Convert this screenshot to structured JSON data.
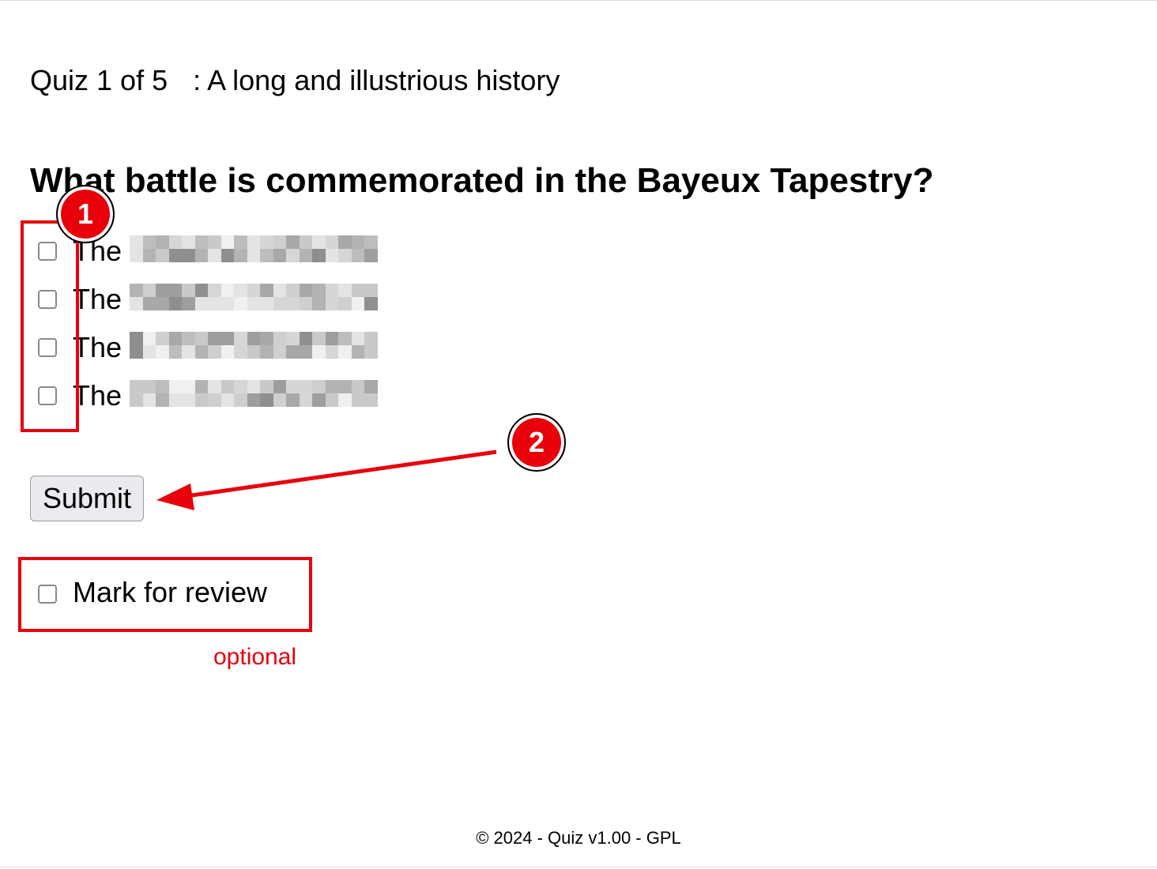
{
  "quiz": {
    "progress": "Quiz 1 of 5",
    "separator": ":",
    "title": "A long and illustrious history"
  },
  "question": {
    "text": "What battle is commemorated in the Bayeux Tapestry?",
    "options": [
      {
        "prefix": "The",
        "redacted": true,
        "checked": false
      },
      {
        "prefix": "The",
        "redacted": true,
        "checked": false
      },
      {
        "prefix": "The",
        "redacted": true,
        "checked": false
      },
      {
        "prefix": "The",
        "redacted": true,
        "checked": false
      }
    ]
  },
  "actions": {
    "submit_label": "Submit",
    "mark_review_label": "Mark for review",
    "mark_review_checked": false
  },
  "annotations": {
    "badge_1": "1",
    "badge_2": "2",
    "optional_note": "optional",
    "color": "#e8000b"
  },
  "footer": {
    "text": "© 2024 - Quiz v1.00 - GPL"
  }
}
